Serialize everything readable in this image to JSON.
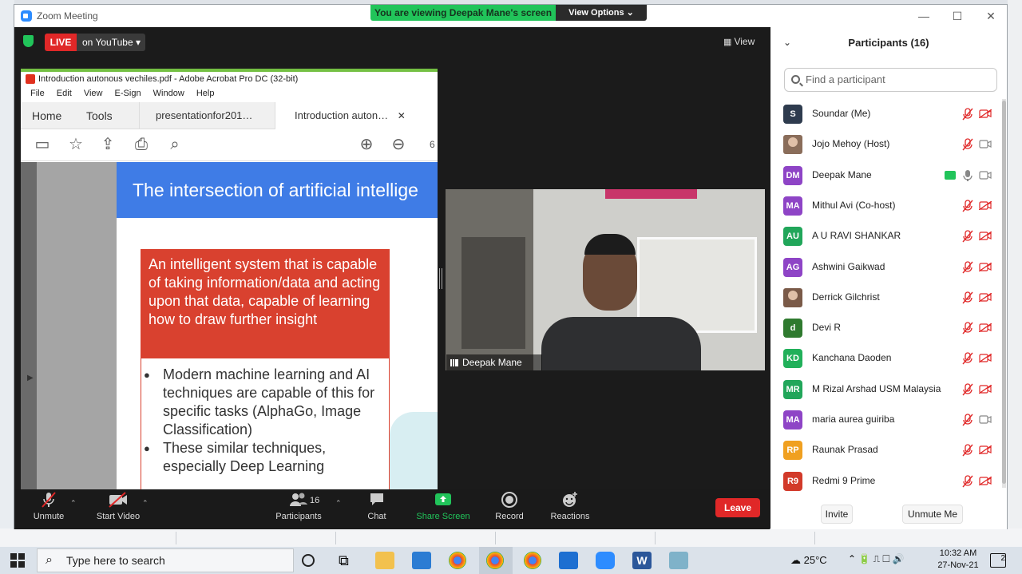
{
  "window": {
    "title": "Zoom Meeting",
    "viewing_banner": "You are viewing Deepak Mane's screen",
    "view_options": "View Options ⌄",
    "minimize": "—",
    "maximize": "☐",
    "close": "✕"
  },
  "meeting": {
    "live_label": "LIVE",
    "live_target": "on YouTube ▾",
    "view_label": "View"
  },
  "acrobat": {
    "title": "Introduction autonous vechiles.pdf - Adobe Acrobat Pro DC (32-bit)",
    "menu": [
      "File",
      "Edit",
      "View",
      "E-Sign",
      "Window",
      "Help"
    ],
    "tabs": [
      "Home",
      "Tools",
      "presentationfor201…",
      "Introduction auton…"
    ],
    "tab_close": "✕",
    "page_num": "6",
    "slide": {
      "heading": "The intersection of artificial intellige",
      "red_text": "An intelligent system that is capable of taking information/data and acting upon that data, capable of learning how to draw further insight",
      "bullets": [
        "Modern machine learning and AI techniques are capable of this for specific tasks (AlphaGo, Image Classification)",
        "These similar techniques, especially Deep Learning"
      ]
    }
  },
  "video": {
    "name": "Deepak Mane"
  },
  "controls": {
    "unmute": "Unmute",
    "start_video": "Start Video",
    "participants": "Participants",
    "participants_count": "16",
    "chat": "Chat",
    "share_screen": "Share Screen",
    "record": "Record",
    "reactions": "Reactions",
    "leave": "Leave"
  },
  "panel": {
    "title": "Participants (16)",
    "search_placeholder": "Find a participant",
    "invite": "Invite",
    "unmute_me": "Unmute Me",
    "participants": [
      {
        "initials": "S",
        "name": "Soundar (Me)",
        "color": "#2e3b4e",
        "mic": "off",
        "cam": "off"
      },
      {
        "initials": "",
        "name": "Jojo Mehoy (Host)",
        "color": "#8a6d5a",
        "mic": "off",
        "cam": "on"
      },
      {
        "initials": "DM",
        "name": "Deepak Mane",
        "color": "#8e44c6",
        "mic": "on",
        "cam": "on",
        "sharing": true
      },
      {
        "initials": "MA",
        "name": "Mithul Avi (Co-host)",
        "color": "#8e44c6",
        "mic": "off",
        "cam": "off"
      },
      {
        "initials": "AU",
        "name": "A U RAVI SHANKAR",
        "color": "#21a65a",
        "mic": "off",
        "cam": "off"
      },
      {
        "initials": "AG",
        "name": "Ashwini Gaikwad",
        "color": "#8e44c6",
        "mic": "off",
        "cam": "off"
      },
      {
        "initials": "",
        "name": "Derrick Gilchrist",
        "color": "#7a5a48",
        "mic": "off",
        "cam": "off"
      },
      {
        "initials": "d",
        "name": "Devi R",
        "color": "#2f7a2f",
        "mic": "off",
        "cam": "off"
      },
      {
        "initials": "KD",
        "name": "Kanchana Daoden",
        "color": "#21b05a",
        "mic": "off",
        "cam": "off"
      },
      {
        "initials": "MR",
        "name": "M Rizal Arshad USM Malaysia",
        "color": "#21a65a",
        "mic": "off",
        "cam": "off"
      },
      {
        "initials": "MA",
        "name": "maria aurea guiriba",
        "color": "#8e44c6",
        "mic": "off",
        "cam": "on"
      },
      {
        "initials": "RP",
        "name": "Raunak Prasad",
        "color": "#f0a020",
        "mic": "off",
        "cam": "off"
      },
      {
        "initials": "R9",
        "name": "Redmi 9 Prime",
        "color": "#d23a2a",
        "mic": "off",
        "cam": "off"
      }
    ]
  },
  "taskbar": {
    "search_placeholder": "Type here to search",
    "weather": "25°C",
    "time": "10:32 AM",
    "date": "27-Nov-21",
    "notifications": "2"
  },
  "colors": {
    "zoom_blue": "#2d8cff",
    "live_red": "#e02828",
    "banner_green": "#21c45a",
    "slide_blue": "#3f7ce6",
    "slide_red": "#d9412f"
  }
}
